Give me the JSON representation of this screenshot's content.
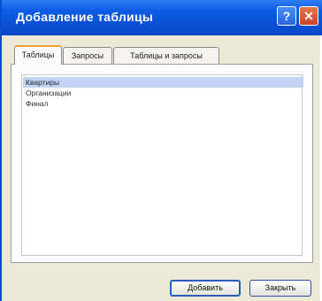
{
  "window": {
    "title": "Добавление таблицы"
  },
  "titlebar_buttons": {
    "help": "?",
    "close": "✕"
  },
  "tabs": [
    {
      "label": "Таблицы",
      "active": true
    },
    {
      "label": "Запросы",
      "active": false
    },
    {
      "label": "Таблицы и запросы",
      "active": false
    }
  ],
  "list": {
    "items": [
      {
        "label": "Квартиры",
        "selected": true
      },
      {
        "label": "Организации",
        "selected": false
      },
      {
        "label": "Финал",
        "selected": false
      }
    ]
  },
  "buttons": {
    "add": "Добавить",
    "close": "Закрыть"
  },
  "colors": {
    "titlebar": "#0a4fd6",
    "dialog_bg": "#ece9d8",
    "selection": "#c2d4f4",
    "active_tab_accent": "#f0a030"
  }
}
